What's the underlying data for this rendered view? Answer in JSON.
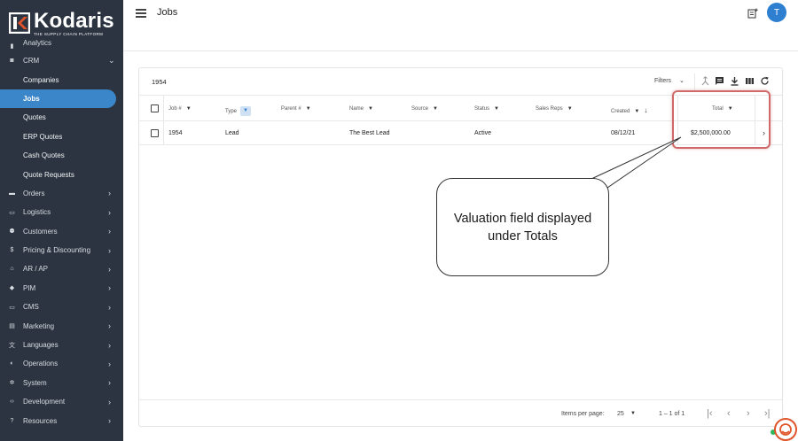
{
  "brand": {
    "name": "Kodaris",
    "tagline": "THE SUPPLY CHAIN PLATFORM"
  },
  "sidebar": {
    "items": [
      {
        "label": "Analytics",
        "icon": "analytics-icon",
        "clipped": true
      },
      {
        "label": "CRM",
        "icon": "crm-icon",
        "chevron": "⌄"
      },
      {
        "label": "Companies",
        "sub": true
      },
      {
        "label": "Jobs",
        "sub": true,
        "active": true
      },
      {
        "label": "Quotes",
        "sub": true
      },
      {
        "label": "ERP Quotes",
        "sub": true
      },
      {
        "label": "Cash Quotes",
        "sub": true
      },
      {
        "label": "Quote Requests",
        "sub": true
      },
      {
        "label": "Orders",
        "icon": "truck-icon",
        "chevron": "›"
      },
      {
        "label": "Logistics",
        "icon": "shipping-icon",
        "chevron": "›"
      },
      {
        "label": "Customers",
        "icon": "customers-icon",
        "chevron": "›"
      },
      {
        "label": "Pricing & Discounting",
        "icon": "dollar-icon",
        "chevron": "›"
      },
      {
        "label": "AR / AP",
        "icon": "bank-icon",
        "chevron": "›"
      },
      {
        "label": "PIM",
        "icon": "tag-icon",
        "chevron": "›"
      },
      {
        "label": "CMS",
        "icon": "cms-icon",
        "chevron": "›"
      },
      {
        "label": "Marketing",
        "icon": "marketing-icon",
        "chevron": "›"
      },
      {
        "label": "Languages",
        "icon": "translate-icon",
        "chevron": "›"
      },
      {
        "label": "Operations",
        "icon": "operations-icon",
        "chevron": "›"
      },
      {
        "label": "System",
        "icon": "gear-icon",
        "chevron": "›"
      },
      {
        "label": "Development",
        "icon": "code-icon",
        "chevron": "›"
      },
      {
        "label": "Resources",
        "icon": "help-icon",
        "chevron": "›"
      }
    ]
  },
  "header": {
    "title": "Jobs",
    "avatar_initial": "T"
  },
  "table": {
    "search_value": "1954",
    "filters_label": "Filters",
    "columns": [
      "Job #",
      "Type",
      "Parent #",
      "Name",
      "Source",
      "Status",
      "Sales Reps",
      "Created",
      "Total"
    ],
    "rows": [
      {
        "job": "1954",
        "type": "Lead",
        "parent": "",
        "name": "The Best Lead",
        "source": "",
        "status": "Active",
        "sales_reps": "",
        "created": "08/12/21",
        "total": "$2,500,000.00"
      }
    ],
    "footer": {
      "items_per_page_label": "Items per page:",
      "items_per_page": "25",
      "range": "1 – 1 of 1"
    }
  },
  "annotation": {
    "callout_text": "Valuation field displayed under Totals",
    "highlight_color": "#d06a6a"
  },
  "colors": {
    "sidebar_bg": "#2b3440",
    "accent": "#3a86c8",
    "avatar": "#2f7fd1",
    "chat_ring": "#e0542b"
  }
}
